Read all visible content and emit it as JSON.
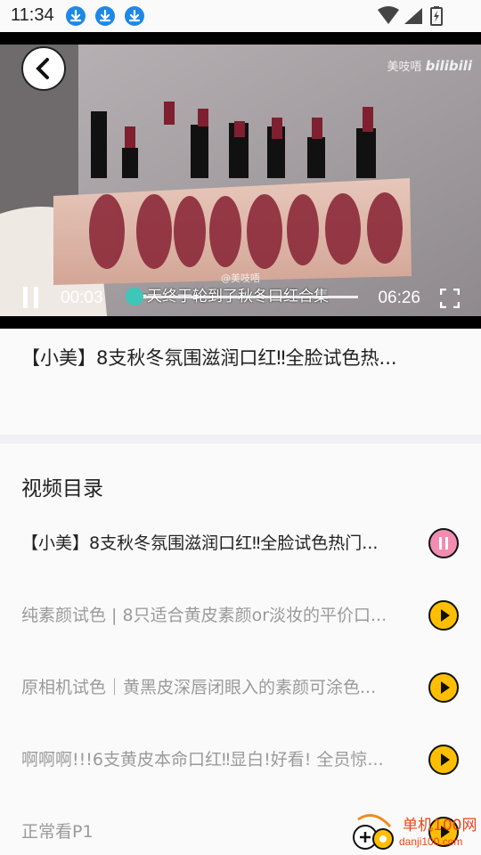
{
  "status_bar": {
    "time": "11:34"
  },
  "video": {
    "watermark_text": "美吱唔",
    "watermark_brand": "bilibili",
    "credit": "@美吱唔",
    "subtitle": "一天终于轮到了秋冬口红合集",
    "current_time": "00:03",
    "total_time": "06:26",
    "progress_percent": 1
  },
  "video_title": "【小美】8支秋冬氛围滋润口红‼全脸试色热...",
  "playlist": {
    "heading": "视频目录",
    "items": [
      {
        "label": "【小美】8支秋冬氛围滋润口红‼全脸试色热门...",
        "state": "playing"
      },
      {
        "label": "纯素颜试色 | 8只适合黄皮素颜or淡妆的平价口...",
        "state": "idle"
      },
      {
        "label": "原相机试色｜黄黑皮深唇闭眼入的素颜可涂色...",
        "state": "idle"
      },
      {
        "label": "啊啊啊!!!6支黄皮本命口红‼显白!好看! 全员惊...",
        "state": "idle"
      },
      {
        "label": "正常看P1",
        "state": "idle"
      }
    ]
  },
  "site_logo": {
    "name": "单机100网",
    "domain": "danji100.com"
  },
  "colors": {
    "accent_play": "#ffbf00",
    "accent_pause": "#f28cb0",
    "seek": "#3ec6b8",
    "download_icon": "#1e88e5"
  }
}
